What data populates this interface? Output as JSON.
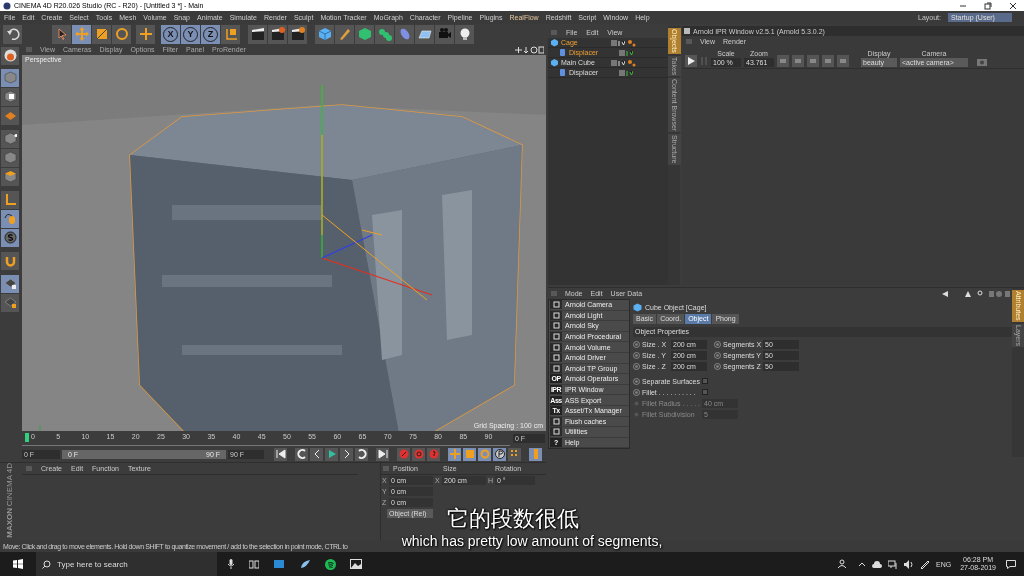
{
  "title_bar": {
    "title": "CINEMA 4D R20.026 Studio (RC - R20) - [Untitled 3 *] - Main"
  },
  "menu_bar": {
    "items": [
      "File",
      "Edit",
      "Create",
      "Select",
      "Tools",
      "Mesh",
      "Volume",
      "Snap",
      "Animate",
      "Simulate",
      "Render",
      "Sculpt",
      "Motion Tracker",
      "MoGraph",
      "Character",
      "Pipeline",
      "Plugins",
      "RealFlow",
      "Redshift",
      "Script",
      "Window",
      "Help"
    ],
    "layout_label": "Layout:",
    "layout_value": "Startup (User)"
  },
  "toolbar": {
    "axis_buttons": [
      "X",
      "Y",
      "Z"
    ]
  },
  "viewport": {
    "menu": [
      "View",
      "Cameras",
      "Display",
      "Options",
      "Filter",
      "Panel",
      "ProRender"
    ],
    "camera_label": "Perspective",
    "grid_spacing": "Grid Spacing : 100 cm"
  },
  "object_manager": {
    "menu": [
      "File",
      "Edit",
      "View"
    ],
    "tree": [
      {
        "name": "Cage",
        "selected": true,
        "children": [
          {
            "name": "Displacer",
            "selected": true
          }
        ]
      },
      {
        "name": "Main Cube",
        "selected": false,
        "children": [
          {
            "name": "Displacer",
            "selected": false
          }
        ]
      }
    ]
  },
  "side_tabs_upper": [
    {
      "label": "Objects",
      "selected": true
    },
    {
      "label": "Takes",
      "selected": false
    },
    {
      "label": "Content Browser",
      "selected": false
    },
    {
      "label": "Structure",
      "selected": false
    }
  ],
  "ipr_window": {
    "title": "Arnold IPR Window v2.5.1 (Arnold 5.3.0.2)",
    "menu": [
      "View",
      "Render"
    ],
    "scale_label": "Scale",
    "scale_value": "100 %",
    "zoom_label": "Zoom",
    "zoom_value": "43.761",
    "display_label": "Display",
    "display_value": "beauty",
    "camera_label": "Camera",
    "camera_value": "<active camera>"
  },
  "attributes": {
    "menu": [
      "Mode",
      "Edit",
      "User Data"
    ],
    "arnold_menu": [
      {
        "label": "Arnold Camera"
      },
      {
        "label": "Arnold Light"
      },
      {
        "label": "Arnold Sky"
      },
      {
        "label": "Arnold Procedural"
      },
      {
        "label": "Arnold Volume"
      },
      {
        "label": "Arnold Driver"
      },
      {
        "label": "Arnold TP Group"
      },
      {
        "label": "Arnold Operators",
        "icon_text": "OP"
      },
      {
        "label": "IPR Window",
        "icon_text": "IPR"
      },
      {
        "label": "ASS Export",
        "icon_text": "Ass"
      },
      {
        "label": "Asset/Tx Manager",
        "icon_text": "Tx"
      },
      {
        "label": "Flush caches"
      },
      {
        "label": "Utilities"
      },
      {
        "label": "Help",
        "icon_text": "?"
      }
    ],
    "object_title": "Cube Object [Cage]",
    "tabs": [
      {
        "label": "Basic",
        "selected": false
      },
      {
        "label": "Coord.",
        "selected": false
      },
      {
        "label": "Object",
        "selected": true
      },
      {
        "label": "Phong",
        "selected": false
      }
    ],
    "section": "Object Properties",
    "size_fields": [
      {
        "label": "Size . X",
        "value": "200 cm"
      },
      {
        "label": "Size . Y",
        "value": "200 cm"
      },
      {
        "label": "Size . Z",
        "value": "200 cm"
      }
    ],
    "segment_fields": [
      {
        "label": "Segments X",
        "value": "50"
      },
      {
        "label": "Segments Y",
        "value": "50"
      },
      {
        "label": "Segments Z",
        "value": "50"
      }
    ],
    "options": [
      {
        "label": "Separate Surfaces",
        "checked": false
      },
      {
        "label": "Fillet . . . . . . . . . .",
        "checked": false
      }
    ],
    "fillet_fields": [
      {
        "label": "Fillet Radius . . . . .",
        "value": "40 cm",
        "disabled": true
      },
      {
        "label": "Fillet Subdivision",
        "value": "5",
        "disabled": true
      }
    ]
  },
  "side_tabs_lower": [
    {
      "label": "Attributes",
      "selected": true
    },
    {
      "label": "Layers",
      "selected": false
    }
  ],
  "timeline": {
    "ticks": [
      "0",
      "5",
      "10",
      "15",
      "20",
      "25",
      "30",
      "35",
      "40",
      "45",
      "50",
      "55",
      "60",
      "65",
      "70",
      "75",
      "80",
      "85",
      "90"
    ],
    "current_frame": "0 F",
    "start": "0 F",
    "range_start": "0 F",
    "range_end": "90 F",
    "end": "90 F"
  },
  "material_manager": {
    "menu": [
      "Create",
      "Edit",
      "Function",
      "Texture"
    ]
  },
  "brand": {
    "maker": "MAXON",
    "product": "CINEMA 4D"
  },
  "coordinates": {
    "headers": [
      "Position",
      "Size",
      "Rotation"
    ],
    "rows": [
      {
        "axis": "X",
        "position": "0 cm",
        "size_axis": "X",
        "size": "200 cm",
        "rot_axis": "H",
        "rotation": "0 °"
      },
      {
        "axis": "Y",
        "position": "0 cm"
      },
      {
        "axis": "Z",
        "position": "0 cm"
      }
    ],
    "mode": "Object (Rel)"
  },
  "status_bar": "Move: Click and drag to move elements. Hold down SHIFT to quantize movement / add to the selection in point mode, CTRL to",
  "subtitles": {
    "chinese": "它的段数很低",
    "english": "which has pretty low amount of segments,"
  },
  "taskbar": {
    "search_placeholder": "Type here to search",
    "language": "ENG",
    "time": "06:28 PM",
    "date": "27-08-2019"
  }
}
